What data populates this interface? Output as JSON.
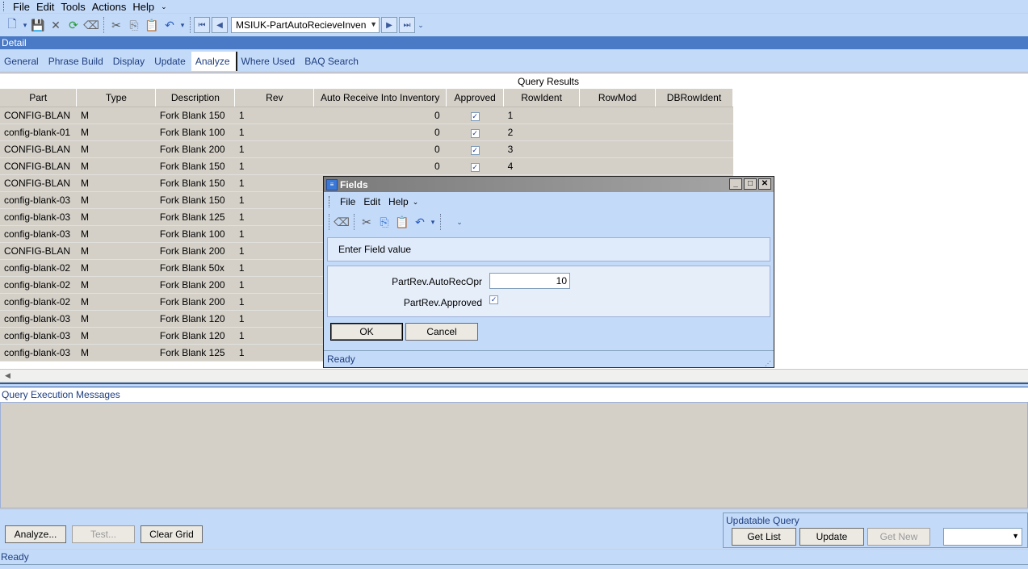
{
  "menu": [
    "File",
    "Edit",
    "Tools",
    "Actions",
    "Help"
  ],
  "toolbar": {
    "record_combo": "MSIUK-PartAutoRecieveInven"
  },
  "detail_label": "Detail",
  "tabs": [
    {
      "label": "General"
    },
    {
      "label": "Phrase Build"
    },
    {
      "label": "Display"
    },
    {
      "label": "Update"
    },
    {
      "label": "Analyze",
      "active": true
    },
    {
      "label": "Where Used"
    },
    {
      "label": "BAQ Search"
    }
  ],
  "results": {
    "title": "Query Results",
    "columns": [
      "Part",
      "Type",
      "Description",
      "Rev",
      "Auto Receive Into Inventory",
      "Approved",
      "RowIdent",
      "RowMod",
      "DBRowIdent"
    ],
    "rows": [
      {
        "part": "CONFIG-BLAN",
        "type": "M",
        "desc": "Fork Blank 150",
        "rev": "1",
        "auto": "0",
        "approved": true,
        "rowident": "1"
      },
      {
        "part": "config-blank-01",
        "type": "M",
        "desc": "Fork Blank 100",
        "rev": "1",
        "auto": "0",
        "approved": true,
        "rowident": "2"
      },
      {
        "part": "CONFIG-BLAN",
        "type": "M",
        "desc": "Fork Blank 200",
        "rev": "1",
        "auto": "0",
        "approved": true,
        "rowident": "3"
      },
      {
        "part": "CONFIG-BLAN",
        "type": "M",
        "desc": "Fork Blank 150",
        "rev": "1",
        "auto": "0",
        "approved": true,
        "rowident": "4"
      },
      {
        "part": "CONFIG-BLAN",
        "type": "M",
        "desc": "Fork Blank 150",
        "rev": "1"
      },
      {
        "part": "config-blank-03",
        "type": "M",
        "desc": "Fork Blank 150",
        "rev": "1"
      },
      {
        "part": "config-blank-03",
        "type": "M",
        "desc": "Fork Blank 125",
        "rev": "1"
      },
      {
        "part": "config-blank-03",
        "type": "M",
        "desc": "Fork Blank 100",
        "rev": "1"
      },
      {
        "part": "CONFIG-BLAN",
        "type": "M",
        "desc": "Fork Blank 200",
        "rev": "1"
      },
      {
        "part": "config-blank-02",
        "type": "M",
        "desc": "Fork Blank 50x",
        "rev": "1"
      },
      {
        "part": "config-blank-02",
        "type": "M",
        "desc": "Fork Blank 200",
        "rev": "1"
      },
      {
        "part": "config-blank-02",
        "type": "M",
        "desc": "Fork Blank 200",
        "rev": "1"
      },
      {
        "part": "config-blank-03",
        "type": "M",
        "desc": "Fork Blank 120",
        "rev": "1"
      },
      {
        "part": "config-blank-03",
        "type": "M",
        "desc": "Fork Blank 120",
        "rev": "1"
      },
      {
        "part": "config-blank-03",
        "type": "M",
        "desc": "Fork Blank 125",
        "rev": "1"
      }
    ]
  },
  "messages": {
    "title": "Query Execution Messages"
  },
  "buttons": {
    "analyze": "Analyze...",
    "test": "Test...",
    "clear_grid": "Clear Grid"
  },
  "updatable": {
    "title": "Updatable Query",
    "get_list": "Get List",
    "update": "Update",
    "get_new": "Get New"
  },
  "status": "Ready",
  "dialog": {
    "title": "Fields",
    "menu": [
      "File",
      "Edit",
      "Help"
    ],
    "prompt": "Enter Field value",
    "field1_label": "PartRev.AutoRecOpr",
    "field1_value": "10",
    "field2_label": "PartRev.Approved",
    "field2_checked": true,
    "ok": "OK",
    "cancel": "Cancel",
    "status": "Ready"
  }
}
